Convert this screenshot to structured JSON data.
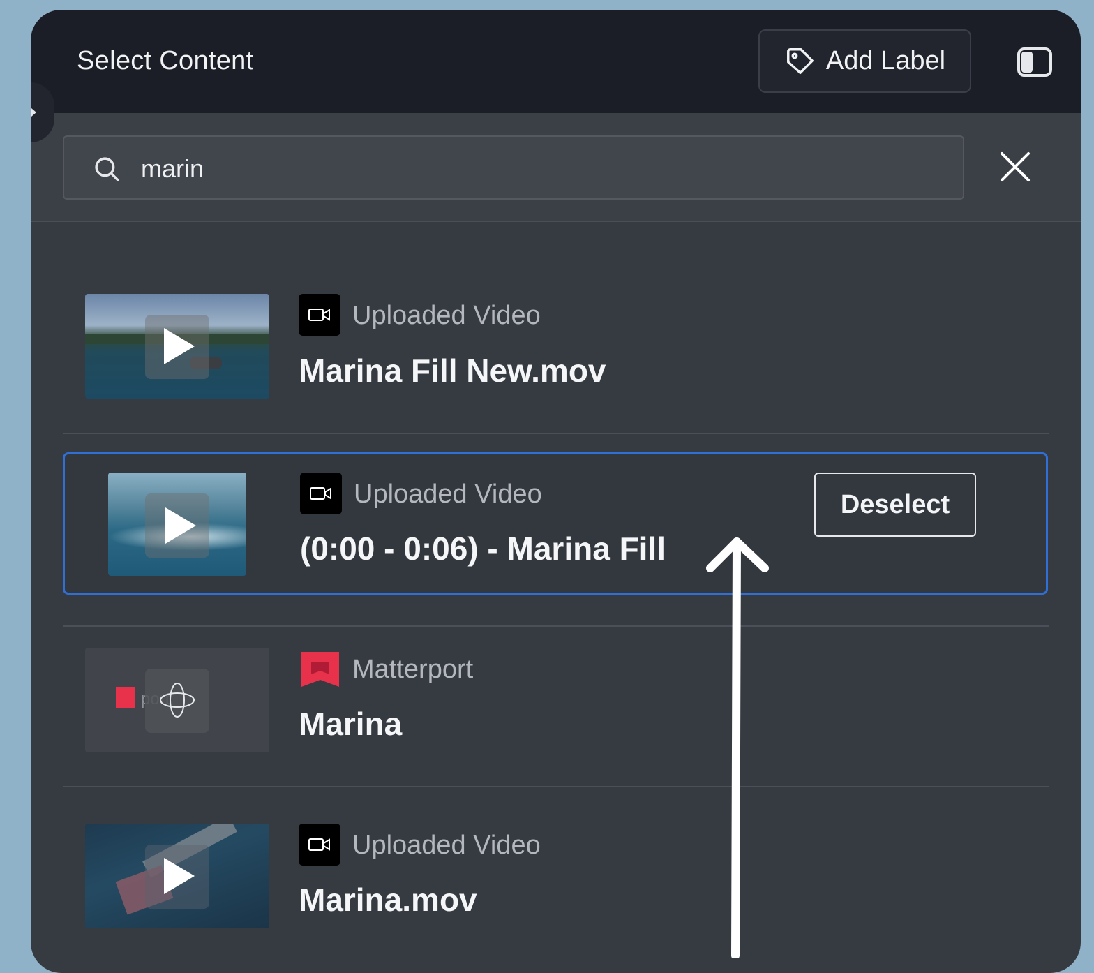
{
  "header": {
    "title": "Select Content",
    "add_label_button": "Add Label"
  },
  "search": {
    "value": "marin",
    "placeholder": ""
  },
  "results": [
    {
      "type": "Uploaded Video",
      "title": "Marina Fill New.mov",
      "icon": "video-camera-icon",
      "thumbnail": "video-thumbnail"
    },
    {
      "type": "Uploaded Video",
      "title": "(0:00 - 0:06) - Marina Fill",
      "icon": "video-camera-icon",
      "thumbnail": "video-thumbnail",
      "selected": true,
      "action": "Deselect"
    },
    {
      "type": "Matterport",
      "title": "Marina",
      "icon": "matterport-logo-icon",
      "thumbnail": "matterport-thumbnail"
    },
    {
      "type": "Uploaded Video",
      "title": "Marina.mov",
      "icon": "video-camera-icon",
      "thumbnail": "video-thumbnail"
    }
  ],
  "colors": {
    "page_background": "#8fb2c8",
    "panel": "#363a41",
    "header": "#1b1e27",
    "selection_border": "#2f6fd6",
    "matterport_red": "#e8314a"
  }
}
